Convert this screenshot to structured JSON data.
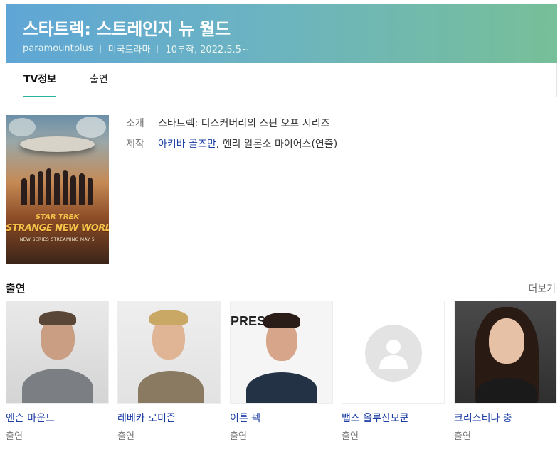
{
  "header": {
    "title": "스타트렉: 스트레인지 뉴 월드",
    "channel": "paramountplus",
    "genre": "미국드라마",
    "episodes_date": "10부작, 2022.5.5~",
    "gradient_start": "#5fa6d6",
    "gradient_end": "#77bf98"
  },
  "tabs": [
    {
      "label": "TV정보",
      "active": true
    },
    {
      "label": "출연",
      "active": false
    }
  ],
  "poster": {
    "logo_top": "STAR TREK",
    "logo_main": "STRANGE NEW WORLDS",
    "tagline": "NEW SERIES STREAMING MAY 5"
  },
  "info": {
    "intro_label": "소개",
    "intro_value": "스타트렉: 디스커버리의 스핀 오프 시리즈",
    "production_label": "제작",
    "director_1": "아키바 골즈만",
    "director_sep": ",",
    "director_2": "헨리 알론소 마이어스",
    "director_role": "(연출)"
  },
  "cast_section": {
    "title": "출연",
    "more_label": "더보기",
    "link_color": "#1d3fa5",
    "items": [
      {
        "name": "앤슨 마운트",
        "role": "출연"
      },
      {
        "name": "레베카 로미즌",
        "role": "출연"
      },
      {
        "name": "이튼 펙",
        "role": "출연"
      },
      {
        "name": "뱁스 올루산모쿤",
        "role": "출연"
      },
      {
        "name": "크리스티나 충",
        "role": "출연"
      }
    ]
  }
}
